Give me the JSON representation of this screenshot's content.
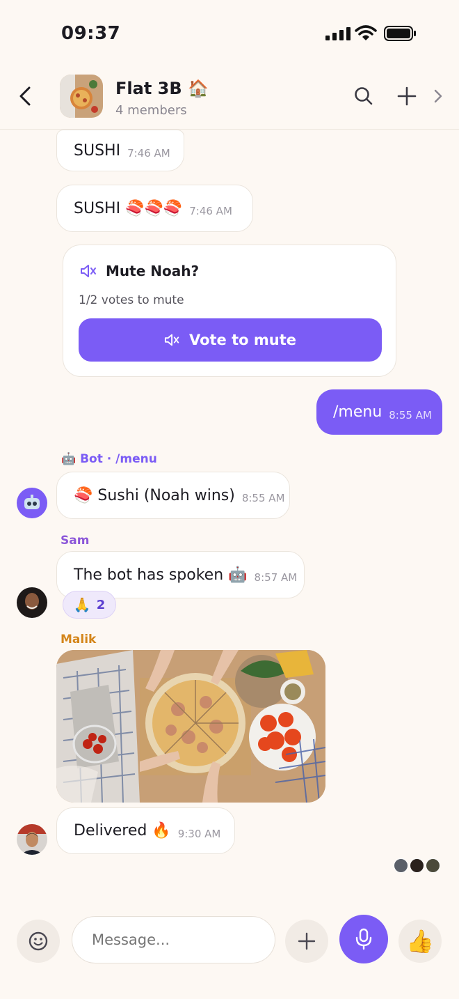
{
  "status_bar": {
    "time": "09:37"
  },
  "header": {
    "title": "Flat 3B 🏠",
    "subtitle": "4 members"
  },
  "messages": {
    "m1": {
      "text": "SUSHI",
      "time": "7:46 AM"
    },
    "m2": {
      "text": "SUSHI 🍣🍣🍣",
      "time": "7:46 AM"
    },
    "poll": {
      "title": "Mute Noah?",
      "votes": "1/2 votes to mute",
      "button": "Vote to mute"
    },
    "m3": {
      "text": "/menu",
      "time": "8:55 AM"
    },
    "bot": {
      "sender": "🤖 Bot · /menu",
      "text": "🍣 Sushi (Noah wins)",
      "time": "8:55 AM"
    },
    "sam": {
      "sender": "Sam",
      "text": "The bot has spoken 🤖",
      "time": "8:57 AM",
      "reaction_emoji": "🙏",
      "reaction_count": "2"
    },
    "malik": {
      "sender": "Malik",
      "text": "Delivered 🔥",
      "time": "9:30 AM"
    }
  },
  "composer": {
    "placeholder": "Message..."
  },
  "colors": {
    "accent": "#7b5cf5",
    "sam": "#8c57d9",
    "malik": "#d4851a"
  }
}
